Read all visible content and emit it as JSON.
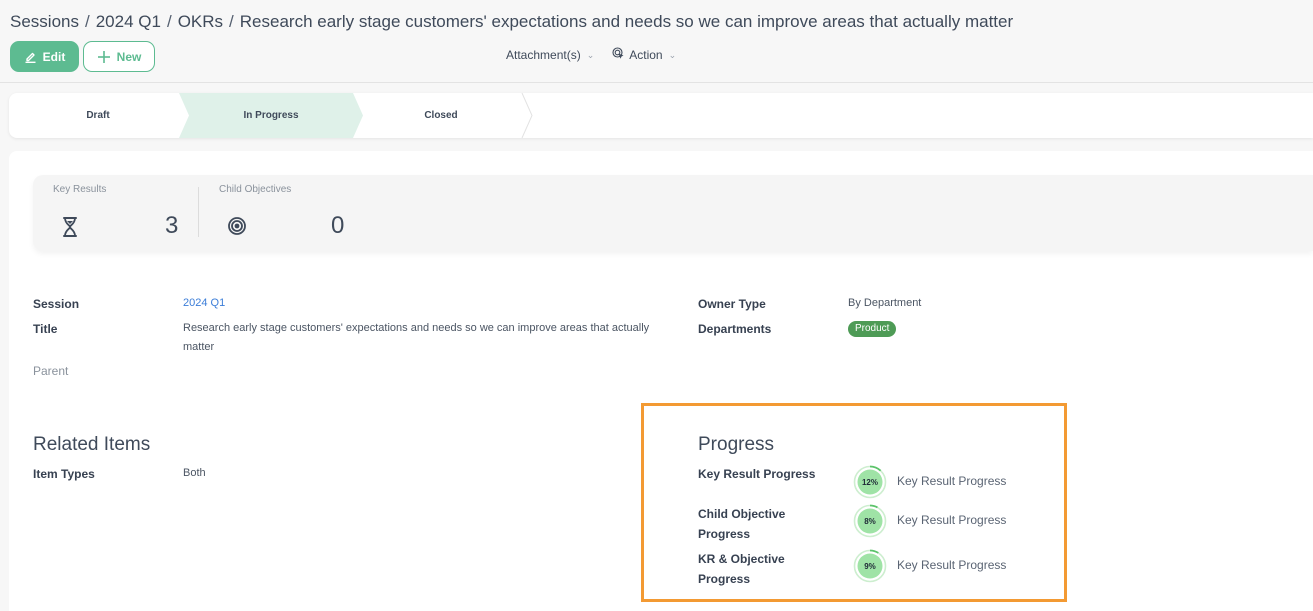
{
  "breadcrumb": {
    "items": [
      "Sessions",
      "2024 Q1",
      "OKRs",
      "Research early stage customers' expectations and needs so we can improve areas that actually matter"
    ],
    "separator": "/"
  },
  "toolbar": {
    "edit_label": "Edit",
    "new_label": "New",
    "attachments_label": "Attachment(s)",
    "action_label": "Action"
  },
  "stages": {
    "items": [
      {
        "label": "Draft",
        "active": false
      },
      {
        "label": "In Progress",
        "active": true
      },
      {
        "label": "Closed",
        "active": false
      }
    ],
    "active_color": "#dff1e9"
  },
  "stats": {
    "key_results": {
      "label": "Key Results",
      "value": "3",
      "icon": "hourglass-icon"
    },
    "child_objectives": {
      "label": "Child Objectives",
      "value": "0",
      "icon": "target-icon"
    }
  },
  "details": {
    "session": {
      "label": "Session",
      "value": "2024 Q1"
    },
    "title": {
      "label": "Title",
      "value": "Research early stage customers' expectations and needs so we can improve areas that actually matter"
    },
    "parent": {
      "label": "Parent",
      "value": ""
    },
    "owner_type": {
      "label": "Owner Type",
      "value": "By Department"
    },
    "departments": {
      "label": "Departments",
      "value": "Product",
      "badge_color": "#4e9b56"
    }
  },
  "related": {
    "title": "Related Items",
    "item_types": {
      "label": "Item Types",
      "value": "Both"
    }
  },
  "progress": {
    "title": "Progress",
    "highlight_color": "#f39a33",
    "rows": [
      {
        "label": "Key Result Progress",
        "percent": 12,
        "percent_text": "12%",
        "caption": "Key Result Progress"
      },
      {
        "label": "Child Objective Progress",
        "percent": 8,
        "percent_text": "8%",
        "caption": "Key Result Progress"
      },
      {
        "label": "KR & Objective Progress",
        "percent": 9,
        "percent_text": "9%",
        "caption": "Key Result Progress"
      }
    ]
  },
  "colors": {
    "accent": "#5dbb91",
    "link": "#3b7dd8",
    "ring_fill": "#9fe3a6",
    "ring_track": "#cdeecf"
  }
}
